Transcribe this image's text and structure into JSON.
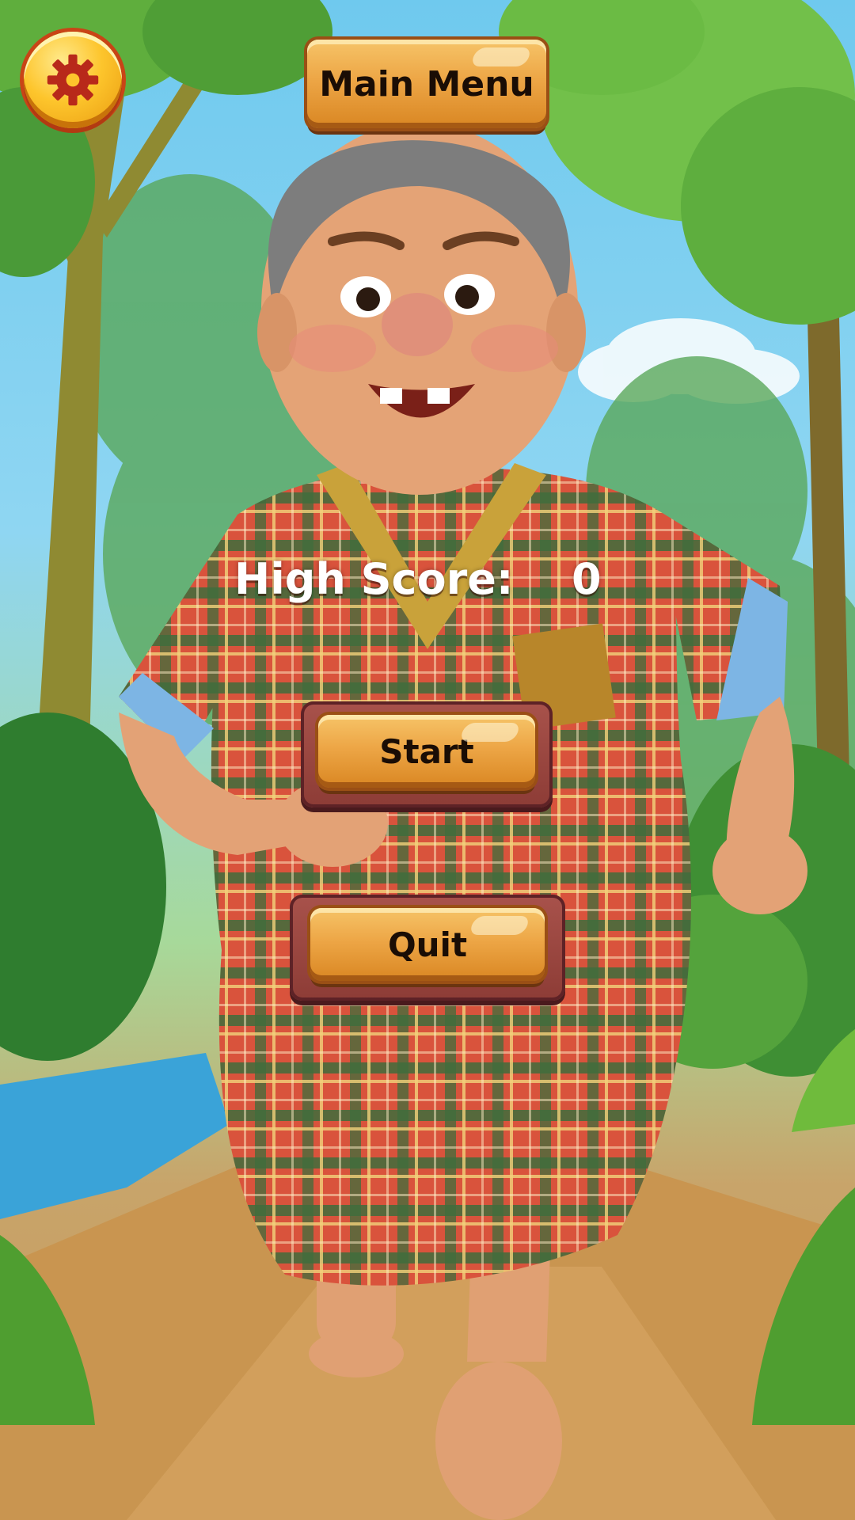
{
  "menu": {
    "main_menu_label": "Main Menu",
    "start_label": "Start",
    "quit_label": "Quit",
    "settings_icon": "gear-icon"
  },
  "score": {
    "label": "High Score:",
    "value": "0"
  },
  "colors": {
    "button_face": "#eda646",
    "button_border": "#9a4f15",
    "plank": "#8d3c36",
    "settings_face": "#fdc52c",
    "settings_gear": "#b8291a",
    "score_text": "#ffffff"
  }
}
